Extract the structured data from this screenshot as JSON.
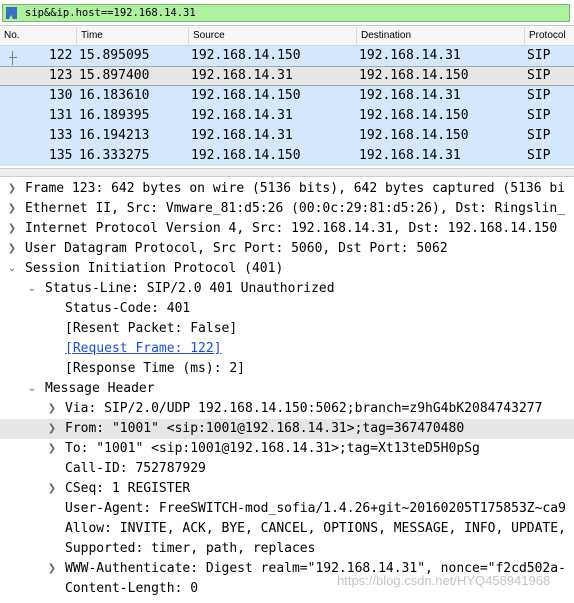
{
  "filter": {
    "text": "sip&&ip.host==192.168.14.31",
    "icon": "bookmark-icon"
  },
  "packet_list": {
    "columns": [
      "No.",
      "Time",
      "Source",
      "Destination",
      "Protocol"
    ],
    "rows": [
      {
        "no": "122",
        "time": "15.895095",
        "source": "192.168.14.150",
        "destination": "192.168.14.31",
        "protocol": "SIP"
      },
      {
        "no": "123",
        "time": "15.897400",
        "source": "192.168.14.31",
        "destination": "192.168.14.150",
        "protocol": "SIP"
      },
      {
        "no": "130",
        "time": "16.183610",
        "source": "192.168.14.150",
        "destination": "192.168.14.31",
        "protocol": "SIP"
      },
      {
        "no": "131",
        "time": "16.189395",
        "source": "192.168.14.31",
        "destination": "192.168.14.150",
        "protocol": "SIP"
      },
      {
        "no": "133",
        "time": "16.194213",
        "source": "192.168.14.31",
        "destination": "192.168.14.150",
        "protocol": "SIP"
      },
      {
        "no": "135",
        "time": "16.333275",
        "source": "192.168.14.150",
        "destination": "192.168.14.31",
        "protocol": "SIP"
      }
    ],
    "selected_row": "123"
  },
  "detail": {
    "lines": [
      {
        "text": "Frame 123: 642 bytes on wire (5136 bits), 642 bytes captured (5136 bi",
        "arrow": "collapsed"
      },
      {
        "text": "Ethernet II, Src: Vmware_81:d5:26 (00:0c:29:81:d5:26), Dst: Ringslin_",
        "arrow": "collapsed"
      },
      {
        "text": "Internet Protocol Version 4, Src: 192.168.14.31, Dst: 192.168.14.150",
        "arrow": "collapsed"
      },
      {
        "text": "User Datagram Protocol, Src Port: 5060, Dst Port: 5062",
        "arrow": "collapsed"
      },
      {
        "text": "Session Initiation Protocol (401)",
        "arrow": "expanded"
      },
      {
        "text": "Status-Line: SIP/2.0 401 Unauthorized",
        "arrow": "expanded"
      },
      {
        "text": "Status-Code: 401",
        "arrow": "none"
      },
      {
        "text": "[Resent Packet: False]",
        "arrow": "none"
      },
      {
        "text": "[Request Frame: 122]",
        "arrow": "none",
        "link": true
      },
      {
        "text": "[Response Time (ms): 2]",
        "arrow": "none"
      },
      {
        "text": "Message Header",
        "arrow": "expanded"
      },
      {
        "text": "Via: SIP/2.0/UDP 192.168.14.150:5062;branch=z9hG4bK2084743277",
        "arrow": "collapsed"
      },
      {
        "text": "From: \"1001\" <sip:1001@192.168.14.31>;tag=367470480",
        "arrow": "collapsed"
      },
      {
        "text": "To: \"1001\" <sip:1001@192.168.14.31>;tag=Xt13teD5H0pSg",
        "arrow": "collapsed"
      },
      {
        "text": "Call-ID: 752787929",
        "arrow": "none"
      },
      {
        "text": "CSeq: 1 REGISTER",
        "arrow": "collapsed"
      },
      {
        "text": "User-Agent: FreeSWITCH-mod_sofia/1.4.26+git~20160205T175853Z~ca9",
        "arrow": "none"
      },
      {
        "text": "Allow: INVITE, ACK, BYE, CANCEL, OPTIONS, MESSAGE, INFO, UPDATE,",
        "arrow": "none"
      },
      {
        "text": "Supported: timer, path, replaces",
        "arrow": "none"
      },
      {
        "text": "WWW-Authenticate: Digest realm=\"192.168.14.31\", nonce=\"f2cd502a-",
        "arrow": "collapsed"
      },
      {
        "text": "Content-Length: 0",
        "arrow": "none"
      }
    ],
    "highlighted_line": 12
  },
  "watermark": "https://blog.csdn.net/HYQ458941968"
}
